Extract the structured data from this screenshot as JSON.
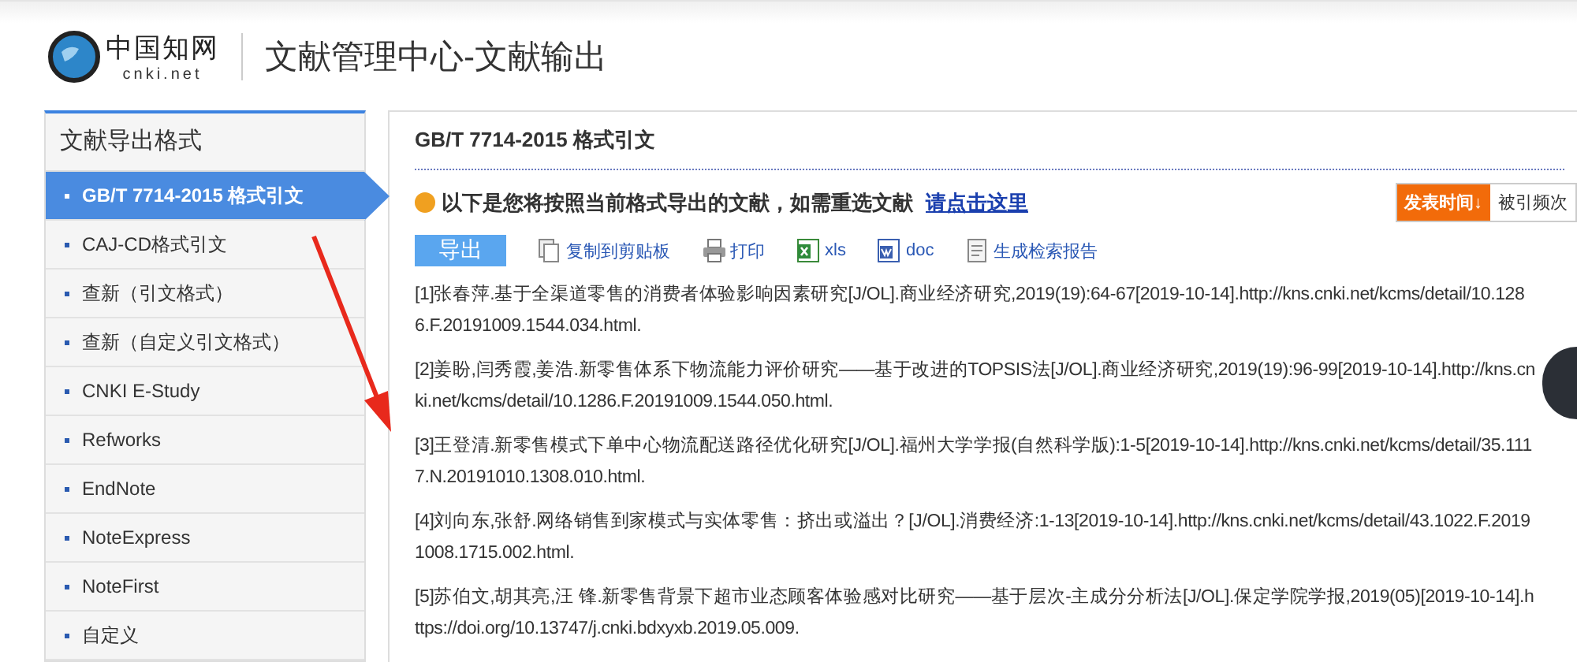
{
  "header": {
    "logo_text": "cnki.net",
    "logo_chinese": "中国知网",
    "title": "文献管理中心-文献输出"
  },
  "sidebar": {
    "title": "文献导出格式",
    "items": [
      {
        "label": "GB/T 7714-2015 格式引文",
        "selected": true
      },
      {
        "label": "CAJ-CD格式引文",
        "selected": false
      },
      {
        "label": "查新（引文格式）",
        "selected": false
      },
      {
        "label": "查新（自定义引文格式）",
        "selected": false
      },
      {
        "label": "CNKI E-Study",
        "selected": false
      },
      {
        "label": "Refworks",
        "selected": false
      },
      {
        "label": "EndNote",
        "selected": false
      },
      {
        "label": "NoteExpress",
        "selected": false
      },
      {
        "label": "NoteFirst",
        "selected": false
      },
      {
        "label": "自定义",
        "selected": false
      }
    ]
  },
  "main": {
    "title": "GB/T 7714-2015 格式引文",
    "notice": {
      "text": "以下是您将按照当前格式导出的文献，如需重选文献",
      "link": "请点击这里"
    },
    "sort": [
      {
        "label": "发表时间",
        "arrow": "↓",
        "selected": true
      },
      {
        "label": "被引频次",
        "selected": false
      }
    ],
    "toolbar": [
      {
        "label": "导出",
        "kind": "primary"
      },
      {
        "label": "复制到剪贴板",
        "kind": "copy"
      },
      {
        "label": "打印",
        "kind": "print"
      },
      {
        "label": "xls",
        "kind": "xls"
      },
      {
        "label": "doc",
        "kind": "doc"
      },
      {
        "label": "生成检索报告",
        "kind": "report"
      }
    ],
    "citations": [
      "[1]张春萍.基于全渠道零售的消费者体验影响因素研究[J/OL].商业经济研究,2019(19):64-67[2019-10-14].http://kns.cnki.net/kcms/detail/10.1286.F.20191009.1544.034.html.",
      "[2]姜盼,闫秀霞,姜浩.新零售体系下物流能力评价研究——基于改进的TOPSIS法[J/OL].商业经济研究,2019(19):96-99[2019-10-14].http://kns.cnki.net/kcms/detail/10.1286.F.20191009.1544.050.html.",
      "[3]王登清.新零售模式下单中心物流配送路径优化研究[J/OL].福州大学学报(自然科学版):1-5[2019-10-14].http://kns.cnki.net/kcms/detail/35.1117.N.20191010.1308.010.html.",
      "[4]刘向东,张舒.网络销售到家模式与实体零售：挤出或溢出？[J/OL].消费经济:1-13[2019-10-14].http://kns.cnki.net/kcms/detail/43.1022.F.20191008.1715.002.html.",
      "[5]苏伯文,胡其亮,汪 锋.新零售背景下超市业态顾客体验感对比研究——基于层次-主成分分析法[J/OL].保定学院学报,2019(05)[2019-10-14].https://doi.org/10.13747/j.cnki.bdxyxb.2019.05.009."
    ]
  }
}
